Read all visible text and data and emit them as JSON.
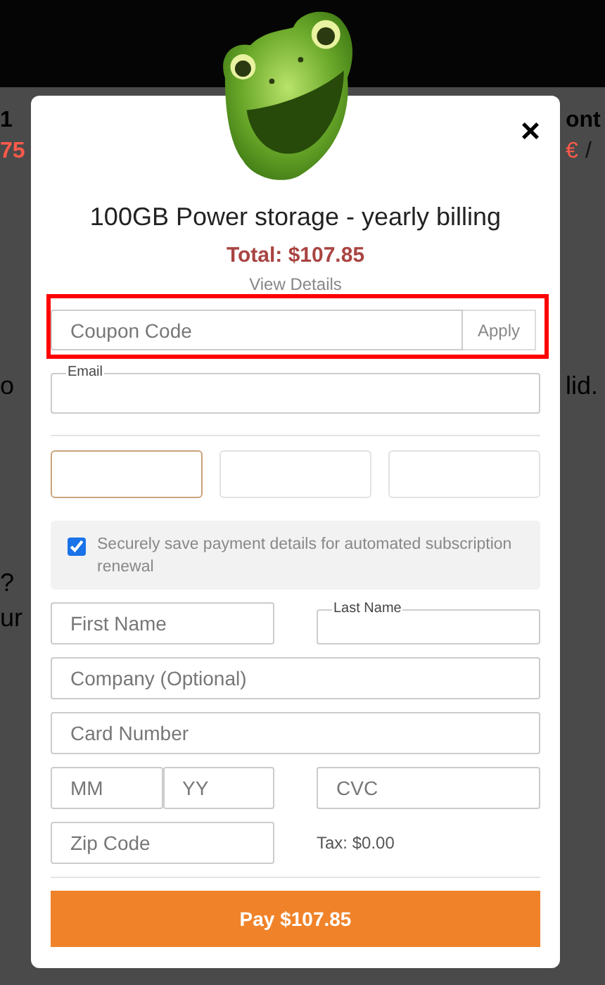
{
  "backdrop": {
    "left_fragments": [
      {
        "text": "1",
        "color": "#000000"
      },
      {
        "text": "75",
        "color": "#ff5a4a"
      },
      {
        "text": "o",
        "color": "#000000"
      },
      {
        "text": "?",
        "color": "#000000"
      },
      {
        "text": "ur",
        "color": "#000000"
      }
    ],
    "right_fragments": [
      {
        "text": "ont",
        "color": "#000000"
      },
      {
        "text": "€",
        "color": "#ff5a4a"
      },
      {
        "text": "/",
        "color": "#111111"
      },
      {
        "text": "lid.",
        "color": "#000000"
      }
    ]
  },
  "modal": {
    "close": "×",
    "title": "100GB Power storage - yearly billing",
    "total": "Total: $107.85",
    "view_details": "View Details",
    "coupon": {
      "placeholder": "Coupon Code",
      "button": "Apply"
    },
    "email": {
      "label": "Email"
    },
    "card_fields": [
      {
        "focused": true
      },
      {
        "focused": false
      },
      {
        "focused": false
      }
    ],
    "save_details": {
      "checked": true,
      "label": "Securely save payment details for automated subscription renewal"
    },
    "first_name": {
      "placeholder": "First Name"
    },
    "last_name": {
      "label": "Last Name"
    },
    "company": {
      "placeholder": "Company (Optional)"
    },
    "card_number": {
      "placeholder": "Card Number"
    },
    "month": {
      "placeholder": "MM"
    },
    "year": {
      "placeholder": "YY"
    },
    "cvc": {
      "placeholder": "CVC"
    },
    "zip": {
      "placeholder": "Zip Code"
    },
    "tax": "Tax: $0.00",
    "pay_button": "Pay $107.85"
  }
}
